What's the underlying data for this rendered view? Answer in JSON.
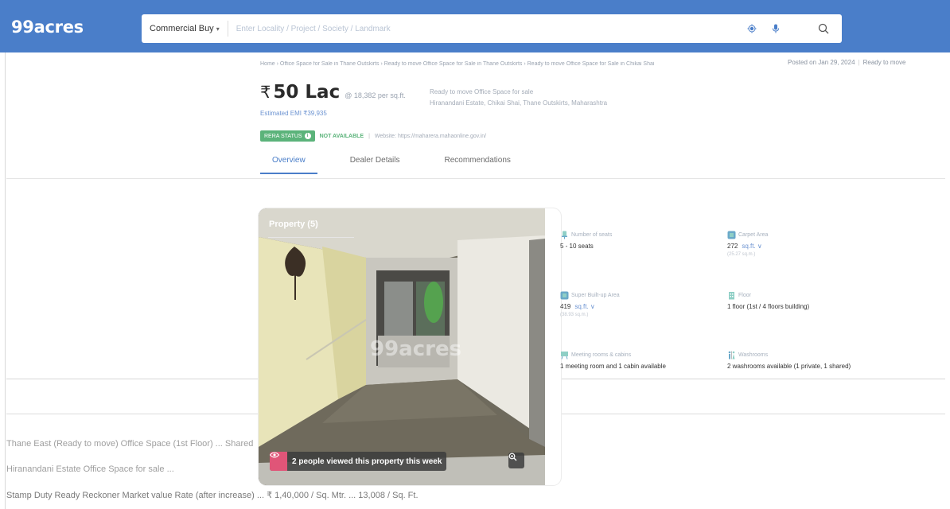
{
  "header": {
    "logo": "99acres",
    "search": {
      "category": "Commercial Buy",
      "placeholder": "Enter Locality / Project / Society / Landmark"
    }
  },
  "breadcrumb": "Home › Office Space for Sale in Thane Outskirts › Ready to move Office Space for Sale in Thane Outskirts › Ready to move Office Space for Sale in Chikai Shai",
  "posted": {
    "date": "Posted on Jan 29, 2024",
    "status": "Ready to move"
  },
  "listing": {
    "rupee": "₹",
    "price": "50 Lac",
    "per_sqft": "@ 18,382 per sq.ft.",
    "emi": "Estimated EMI ₹39,935",
    "title_line1": "Ready to move Office Space for sale",
    "title_line2": "Hiranandani Estate, Chikai Shai, Thane Outskirts, Maharashtra",
    "rera_label": "RERA STATUS",
    "rera_value": "NOT AVAILABLE",
    "rera_website": "Website: https://maharera.mahaonline.gov.in/"
  },
  "tabs": [
    {
      "label": "Overview",
      "active": true
    },
    {
      "label": "Dealer Details",
      "active": false
    },
    {
      "label": "Recommendations",
      "active": false
    }
  ],
  "gallery": {
    "label": "Property (5)",
    "watermark": "99acres",
    "views_text": "2 people viewed this property this week"
  },
  "features": [
    {
      "icon": "seat-icon",
      "label": "Number of seats",
      "value": "5 - 10 seats",
      "unit": "",
      "sub": ""
    },
    {
      "icon": "area-icon",
      "label": "Carpet Area",
      "value": "272",
      "unit": "sq.ft.",
      "sub": "(25.27 sq.m.)"
    },
    {
      "icon": "area-icon",
      "label": "Super Built-up Area",
      "value": "419",
      "unit": "sq.ft.",
      "sub": "(38.93 sq.m.)"
    },
    {
      "icon": "building-icon",
      "label": "Floor",
      "value": "1 floor (1st / 4 floors building)",
      "unit": "",
      "sub": ""
    },
    {
      "icon": "meeting-icon",
      "label": "Meeting rooms & cabins",
      "value": "1 meeting room and 1 cabin available",
      "unit": "",
      "sub": ""
    },
    {
      "icon": "washroom-icon",
      "label": "Washrooms",
      "value": "2 washrooms available (1 private, 1 shared)",
      "unit": "",
      "sub": ""
    }
  ],
  "bottom_rows": [
    "Thane East (Ready to move) Office Space (1st Floor) ... Shared",
    "Hiranandani Estate Office Space for sale ...",
    "Stamp Duty Ready Reckoner Market value Rate (after increase) ... ₹ 1,40,000 / Sq. Mtr. ... 13,008 / Sq. Ft."
  ],
  "colors": {
    "brand": "#4a7ec9",
    "accent_link": "#6c93d1",
    "rera_green": "#5bb37a",
    "views_pink": "#e05578"
  }
}
